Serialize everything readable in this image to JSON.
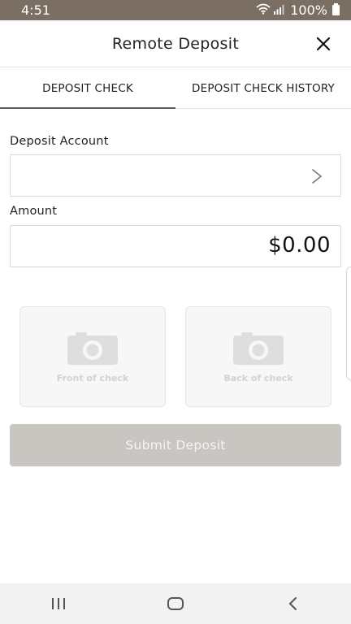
{
  "status_bar": {
    "time": "4:51",
    "battery_text": "100%",
    "icons": [
      "wifi-icon",
      "signal-icon",
      "battery-icon"
    ]
  },
  "header": {
    "title": "Remote Deposit",
    "close_icon": "close-icon"
  },
  "tabs": [
    {
      "label": "DEPOSIT CHECK",
      "active": true
    },
    {
      "label": "DEPOSIT CHECK HISTORY",
      "active": false
    }
  ],
  "form": {
    "deposit_account_label": "Deposit Account",
    "deposit_account_value": "",
    "amount_label": "Amount",
    "amount_value": "$0.00"
  },
  "photos": {
    "front_label": "Front of check",
    "back_label": "Back of check",
    "icon": "camera-icon"
  },
  "submit": {
    "label": "Submit Deposit",
    "enabled": false
  },
  "nav_bar": {
    "icons": [
      "recent-apps-icon",
      "home-icon",
      "back-icon"
    ]
  },
  "colors": {
    "status_bar": "#7a6f62",
    "tab_indicator": "#5c5c5c",
    "submit_disabled": "#c9c6c1",
    "card_background": "#f7f7f7"
  }
}
